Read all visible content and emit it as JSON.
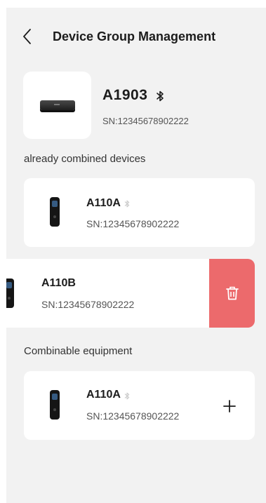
{
  "header": {
    "title": "Device Group Management",
    "back_icon": "chevron-left-icon"
  },
  "main_device": {
    "name": "A1903",
    "sn": "SN:12345678902222",
    "bluetooth_icon": "bluetooth-icon"
  },
  "combined_section": {
    "label": "already combined devices",
    "devices": [
      {
        "name": "A110A",
        "sn": "SN:12345678902222"
      },
      {
        "name": "A110B",
        "sn": "SN:12345678902222",
        "action": "delete",
        "action_icon": "trash-icon",
        "action_color": "#ec6a6c"
      }
    ]
  },
  "combinable_section": {
    "label": "Combinable equipment",
    "devices": [
      {
        "name": "A110A",
        "sn": "SN:12345678902222",
        "action": "add",
        "action_icon": "plus-icon"
      }
    ]
  },
  "colors": {
    "background": "#f2f2f2",
    "card": "#ffffff",
    "delete": "#ec6a6c",
    "text": "#1c1c1c",
    "secondary_text": "#555555"
  }
}
